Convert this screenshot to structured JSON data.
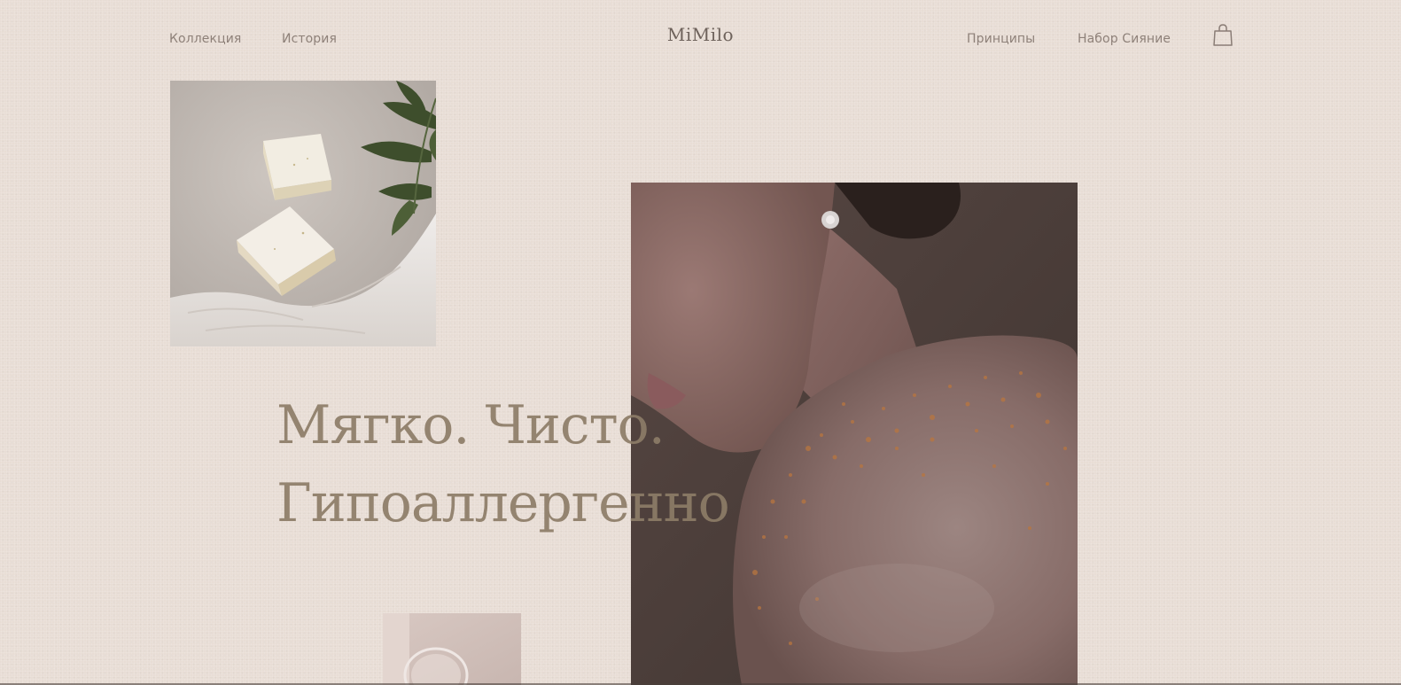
{
  "header": {
    "nav_left": [
      {
        "label": "Коллекция"
      },
      {
        "label": "История"
      }
    ],
    "brand": "MiMilo",
    "nav_right": [
      {
        "label": "Принципы"
      },
      {
        "label": "Набор Сияние"
      }
    ],
    "cart_icon": "shopping-bag-icon"
  },
  "hero": {
    "title_line1": "Мягко. Чисто.",
    "title_line2": "Гипоаллергенно"
  },
  "colors": {
    "background": "#e8ddd5",
    "nav_text": "#8e8179",
    "brand_text": "#6e625b",
    "hero_text": "#8c7c67"
  }
}
